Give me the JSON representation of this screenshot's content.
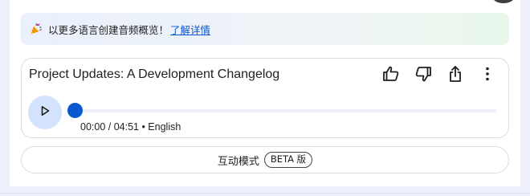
{
  "banner": {
    "icon": "party-popper-icon",
    "text": "以更多语言创建音频概览！",
    "link_label": "了解详情",
    "gradient_colors": [
      "#eaf0fc",
      "#e8f7ea"
    ]
  },
  "audio": {
    "title": "Project Updates: A Development Changelog",
    "current_time": "00:00",
    "duration": "04:51",
    "language": "English",
    "meta_text": "00:00 / 04:51 • English",
    "progress": 0.0,
    "accent_color": "#0b57d0",
    "actions": [
      {
        "name": "thumbs-up-icon"
      },
      {
        "name": "thumbs-down-icon"
      },
      {
        "name": "share-icon"
      },
      {
        "name": "more-vert-icon"
      }
    ]
  },
  "interactive_mode": {
    "label": "互动模式",
    "badge": "BETA 版"
  }
}
